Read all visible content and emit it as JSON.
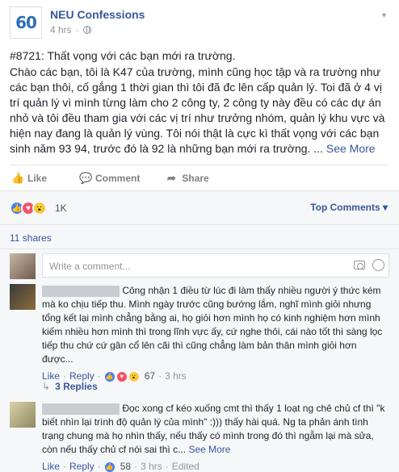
{
  "page": {
    "name": "NEU Confessions",
    "time": "4 hrs",
    "logo_text": "60"
  },
  "post": {
    "title": "#8721: Thất vọng với các bạn mới ra trường.",
    "body": "Chào các bạn, tôi là K47 của trường, mình cũng học tập và ra trường như các bạn thôi, cố gắng 1 thời gian thì tôi đã đc lên cấp quản lý. Toi đã ở 4 vị trí quản lý vì mình từng làm cho 2 công ty, 2 công ty này đều có các dự án nhỏ và tôi đều tham gia với các vị trí như trưởng nhóm, quản lý khu vực và hiện nay đang là quản lý vùng. Tôi nói thật là cực kì thất vọng với các bạn sinh năm 93 94, trước đó là 92 là những bạn mới ra trường. ...",
    "see_more": "See More"
  },
  "actions": {
    "like": "Like",
    "comment": "Comment",
    "share": "Share"
  },
  "reactions": {
    "count": "1K",
    "sort": "Top Comments ▾",
    "shares": "11 shares",
    "icons": [
      "like-icon",
      "love-icon",
      "wow-icon"
    ]
  },
  "composer": {
    "placeholder": "Write a comment..."
  },
  "comments": [
    {
      "text": "Công nhận 1 điều từ lúc đi làm thấy nhiều người ý thức kém mà ko chịu tiếp thu. Mình ngày trước cũng bướng lắm, nghĩ mình giỏi nhưng tổng kết lại mình chẳng bằng ai, họ giỏi hơn mình họ có kinh nghiệm hơn mình kiếm nhiều hơn mình thì trong lĩnh vực ấy, cứ nghe thôi, cái nào tốt thì sàng lọc tiếp thu chứ cứ gân cổ lên cãi thì cũng chẳng làm bản thân mình giỏi hơn được...",
      "like": "Like",
      "reply": "Reply",
      "reaction_count": "67",
      "time": "3 hrs",
      "replies": "3 Replies"
    },
    {
      "text": "Đọc xong cf kéo xuống cmt thì thấy 1 loạt ng chê chủ cf thì \"k biết nhìn lại trình độ quản lý của mình\" :))) thấy hài quá. Ng ta phản ánh tình trạng chung mà họ nhìn thấy, nếu thấy có mình trong đó thì ngẫm lại mà sửa, còn nếu thấy chủ cf nói sai thì c...",
      "see_more": "See More",
      "like": "Like",
      "reply": "Reply",
      "reaction_count": "58",
      "time": "3 hrs",
      "edited": "Edited"
    }
  ],
  "colors": {
    "link": "#365899",
    "like": "#4080ff",
    "love": "#f25268",
    "wow": "#fcd050",
    "muted": "#90949c"
  }
}
